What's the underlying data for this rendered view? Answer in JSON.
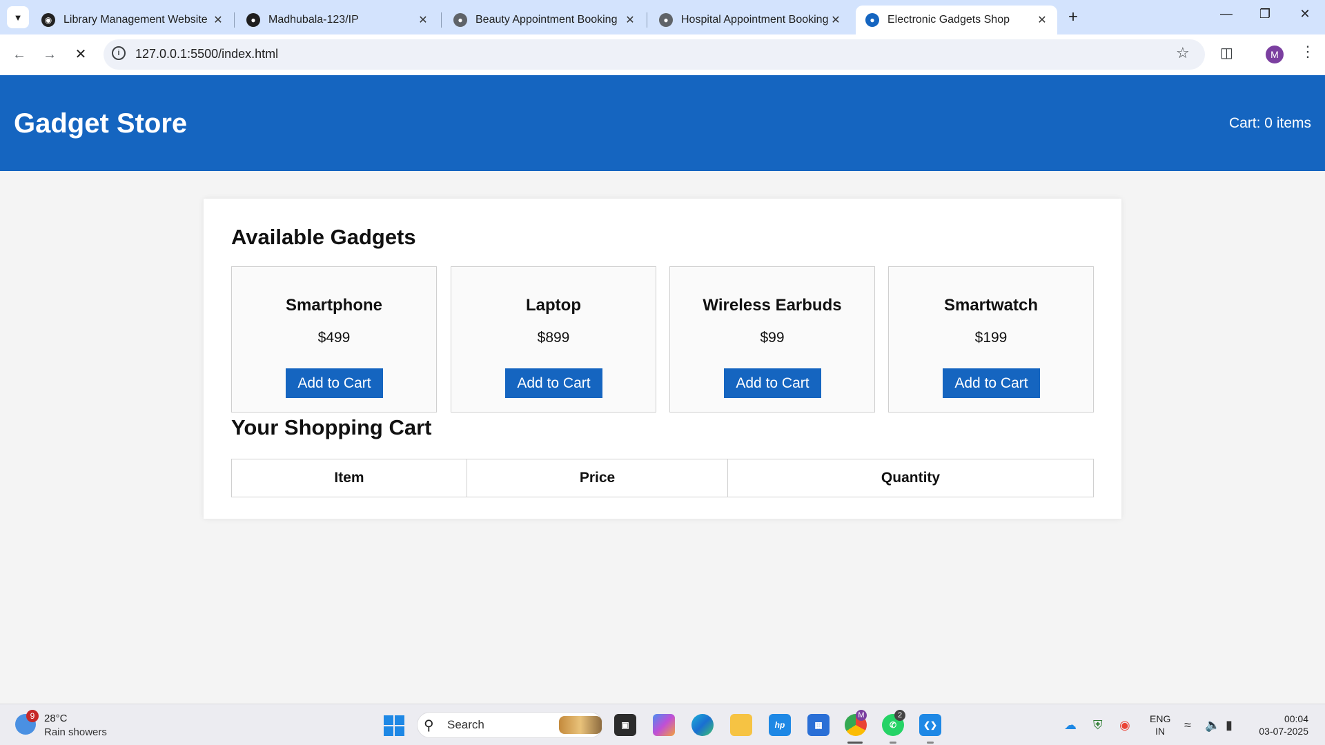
{
  "browser": {
    "tabs": [
      {
        "label": "Library Management Website",
        "active": false
      },
      {
        "label": "Madhubala-123/IP",
        "active": false
      },
      {
        "label": "Beauty Appointment Booking",
        "active": false
      },
      {
        "label": "Hospital Appointment Booking",
        "active": false
      },
      {
        "label": "Electronic Gadgets Shop",
        "active": true
      }
    ],
    "url": "127.0.0.1:5500/index.html",
    "profile_initial": "M"
  },
  "site": {
    "title": "Gadget Store",
    "cart_status": "Cart: 0 items",
    "available_heading": "Available Gadgets",
    "products": [
      {
        "name": "Smartphone",
        "price": "$499",
        "button": "Add to Cart"
      },
      {
        "name": "Laptop",
        "price": "$899",
        "button": "Add to Cart"
      },
      {
        "name": "Wireless Earbuds",
        "price": "$99",
        "button": "Add to Cart"
      },
      {
        "name": "Smartwatch",
        "price": "$199",
        "button": "Add to Cart"
      }
    ],
    "cart_heading": "Your Shopping Cart",
    "cart_columns": [
      "Item",
      "Price",
      "Quantity"
    ],
    "accent_color": "#1565c0"
  },
  "taskbar": {
    "weather_badge": "9",
    "temperature": "28°C",
    "weather": "Rain showers",
    "search_label": "Search",
    "chrome_badge": "M",
    "whatsapp_badge": "2",
    "lang_primary": "ENG",
    "lang_secondary": "IN",
    "time": "00:04",
    "date": "03-07-2025"
  }
}
